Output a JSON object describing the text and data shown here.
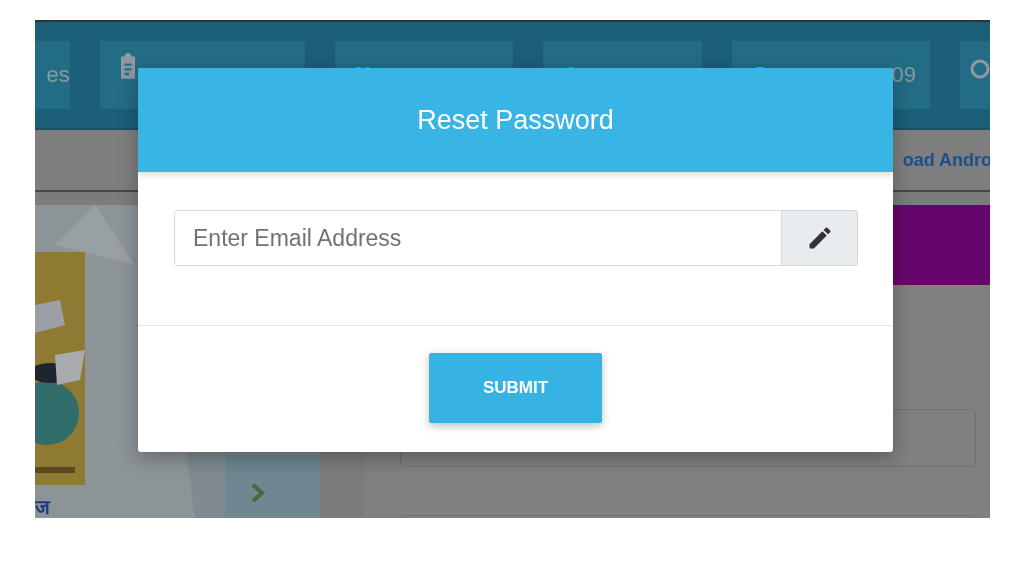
{
  "top_bar": {
    "tile_text_first": "es",
    "tile_text_last": "09"
  },
  "link_bar": {
    "link": "oad Andro"
  },
  "banner": {
    "caption": "ज"
  },
  "dialog": {
    "title": "Reset Password",
    "email_field": {
      "placeholder": "Enter Email Address"
    },
    "submit_button": "SUBMIT"
  }
}
